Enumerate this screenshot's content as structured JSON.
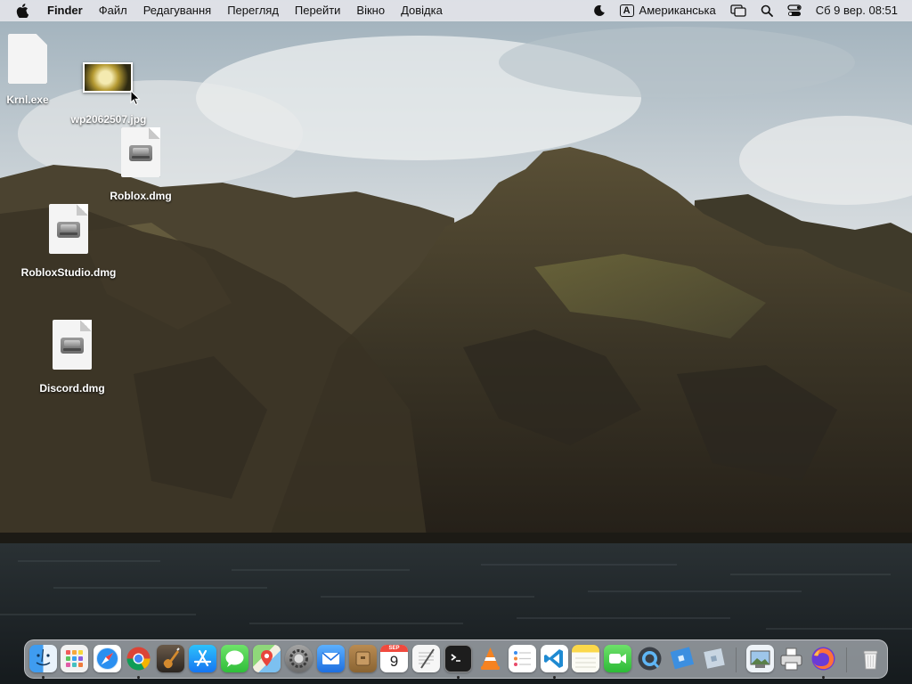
{
  "menubar": {
    "app_name": "Finder",
    "menus": [
      "Файл",
      "Редагування",
      "Перегляд",
      "Перейти",
      "Вікно",
      "Довідка"
    ],
    "input_badge": "A",
    "input_source": "Американська",
    "clock": "Сб 9 вер.  08:51"
  },
  "desktop": {
    "icons": [
      {
        "name": "Krnl.exe",
        "kind": "document"
      },
      {
        "name": "wp2062507.jpg",
        "kind": "image"
      },
      {
        "name": "Roblox.dmg",
        "kind": "disk-image"
      },
      {
        "name": "RobloxStudio.dmg",
        "kind": "disk-image"
      },
      {
        "name": "Discord.dmg",
        "kind": "disk-image"
      }
    ]
  },
  "dock": {
    "calendar_month": "SEP",
    "calendar_day": "9",
    "apps": [
      "Finder",
      "Launchpad",
      "Safari",
      "Chrome",
      "GarageBand",
      "App Store",
      "Messages",
      "Maps",
      "System Preferences",
      "Mail",
      "Archive",
      "Calendar",
      "TextEdit",
      "Terminal",
      "VLC",
      "Reminders",
      "Visual Studio Code",
      "Notes",
      "FaceTime",
      "QuickTime",
      "Roblox",
      "Roblox Studio",
      "Preview",
      "Printer",
      "Firefox",
      "Trash"
    ]
  },
  "colors": {
    "menubar_bg": "#e8e8ec",
    "sky": "#cfd6da",
    "mountain": "#3d3528",
    "sea": "#1e2428"
  }
}
